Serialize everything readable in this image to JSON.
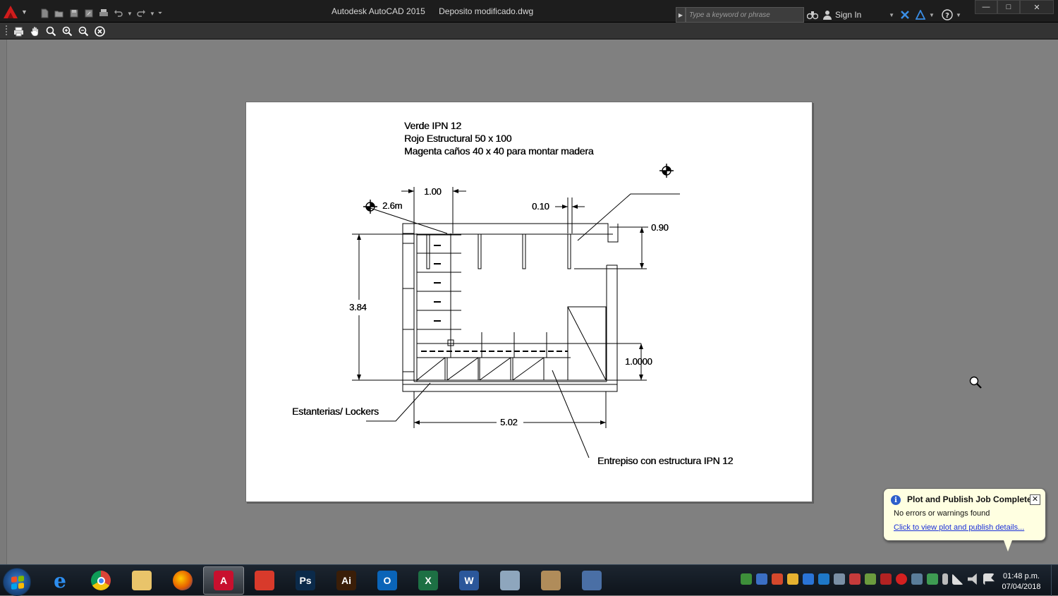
{
  "window": {
    "app_name": "Autodesk AutoCAD 2015",
    "file_name": "Deposito modificado.dwg",
    "search_placeholder": "Type a keyword or phrase",
    "sign_in": "Sign In",
    "minimize": "—",
    "maximize": "□",
    "close": "✕"
  },
  "icons": {
    "app": "autocad-logo-icon",
    "quick_access": [
      "new-icon",
      "open-icon",
      "save-icon",
      "save-as-icon",
      "plot-icon",
      "undo-icon",
      "redo-icon"
    ],
    "preview_tools": [
      "plot-icon",
      "pan-icon",
      "zoom-realtime-icon",
      "zoom-window-icon",
      "zoom-original-icon",
      "close-preview-icon"
    ]
  },
  "drawing": {
    "legend": [
      "Verde IPN 12",
      "Rojo Estructural 50 x 100",
      "Magenta caños 40 x 40 para montar madera"
    ],
    "dimensions": {
      "top_width": "1.00",
      "point_label": "2.6m",
      "gap": "0.10",
      "door": "0.90",
      "height": "3.84",
      "mezzanine": "1.0000",
      "bottom_width": "5.02"
    },
    "labels": {
      "shelves": "Estanterias/ Lockers",
      "mezzanine": "Entrepiso con estructura IPN 12"
    }
  },
  "notification": {
    "title": "Plot and Publish Job Complete",
    "message": "No errors or warnings found",
    "link": "Click to view plot and publish details...",
    "close": "✕",
    "info": "i"
  },
  "taskbar": {
    "apps": [
      {
        "name": "internet-explorer",
        "label": "e",
        "color": "#1e7be0"
      },
      {
        "name": "chrome",
        "label": "",
        "color": "#e8453c"
      },
      {
        "name": "file-explorer",
        "label": "",
        "color": "#e9c46a"
      },
      {
        "name": "firefox",
        "label": "",
        "color": "#e66000"
      },
      {
        "name": "autocad",
        "label": "A",
        "color": "#c8102e"
      },
      {
        "name": "sketchup",
        "label": "",
        "color": "#d83a2b"
      },
      {
        "name": "photoshop",
        "label": "Ps",
        "color": "#0b2a4a"
      },
      {
        "name": "illustrator",
        "label": "Ai",
        "color": "#3a1e08"
      },
      {
        "name": "outlook",
        "label": "O",
        "color": "#0a64b8"
      },
      {
        "name": "excel",
        "label": "X",
        "color": "#1d7044"
      },
      {
        "name": "word",
        "label": "W",
        "color": "#2b579a"
      },
      {
        "name": "calculator",
        "label": "",
        "color": "#8ea6bd"
      },
      {
        "name": "paint",
        "label": "",
        "color": "#b08c5a"
      },
      {
        "name": "scanner",
        "label": "",
        "color": "#4a6fa5"
      }
    ],
    "time": "01:48 p.m.",
    "date": "07/04/2018"
  }
}
